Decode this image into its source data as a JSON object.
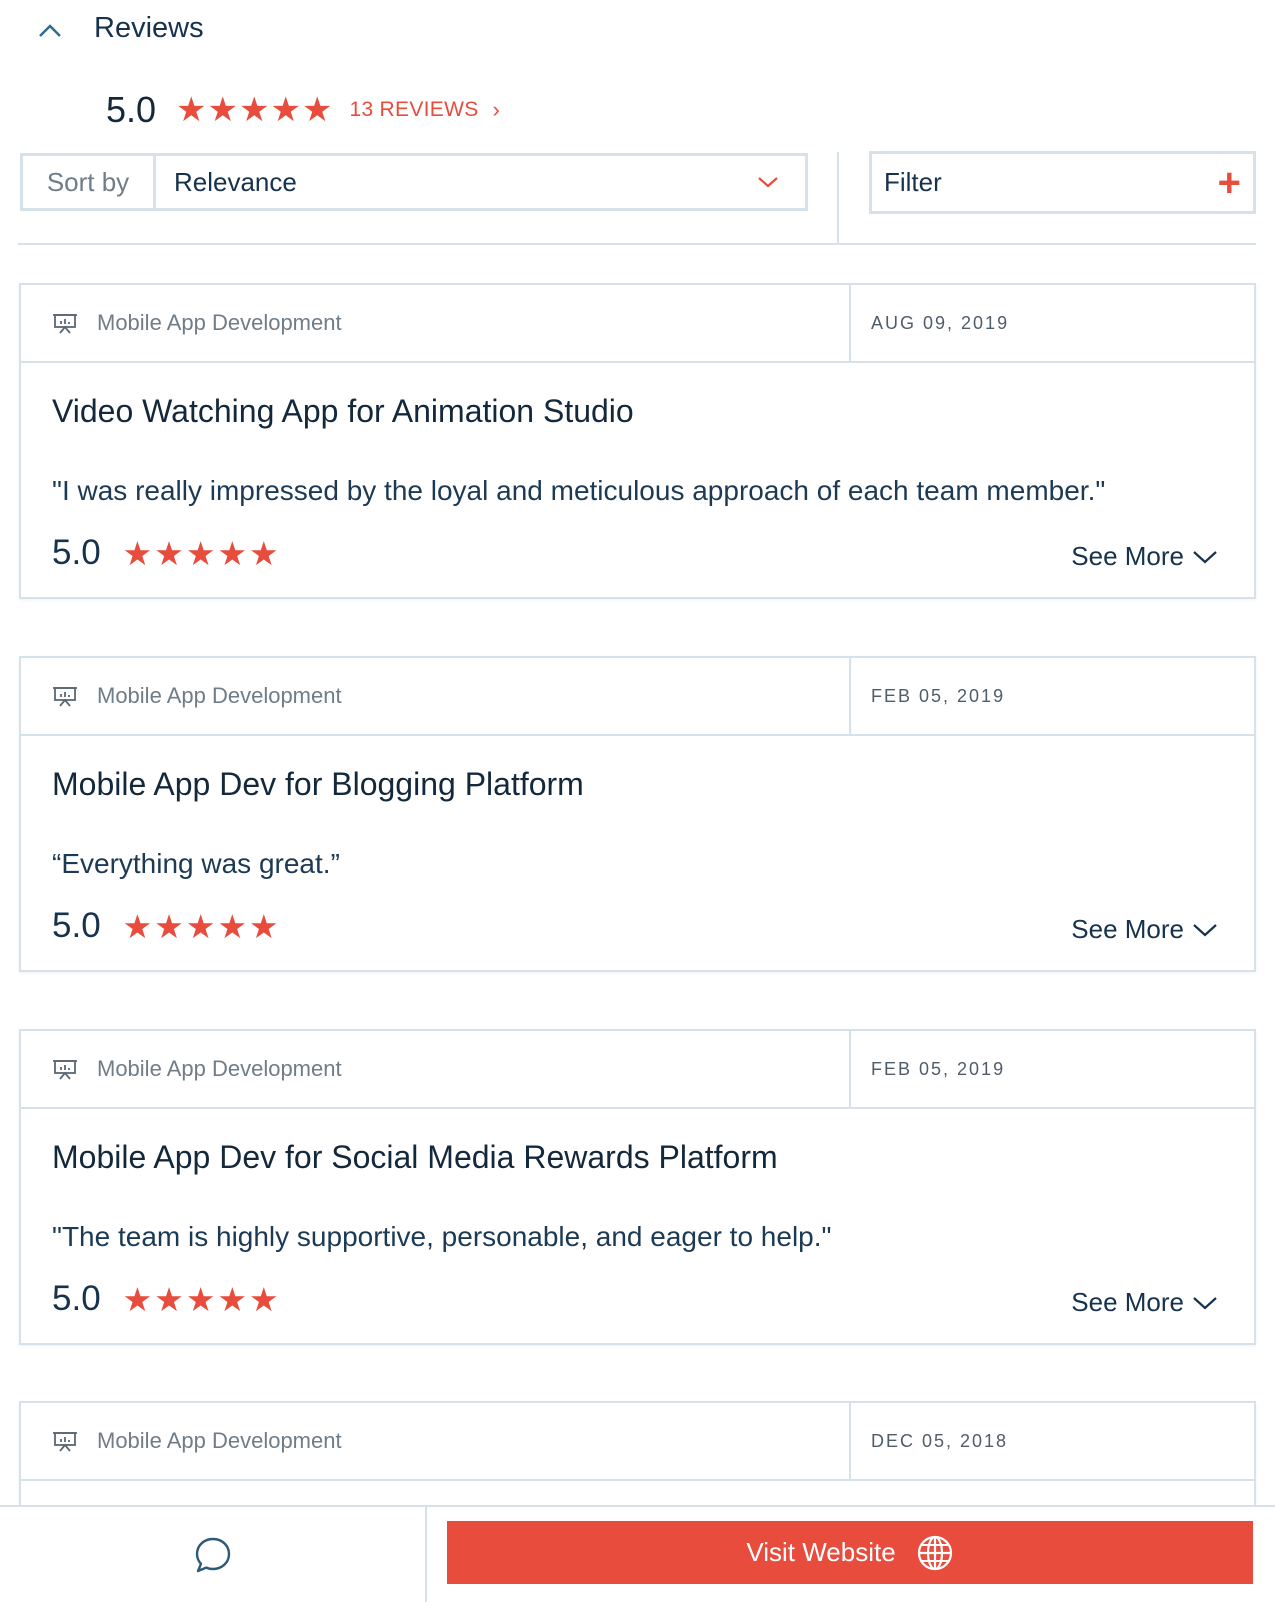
{
  "section": {
    "title": "Reviews"
  },
  "summary": {
    "score": "5.0",
    "stars": 5,
    "reviews_link": "13 REVIEWS"
  },
  "sort": {
    "label": "Sort by",
    "value": "Relevance"
  },
  "filter": {
    "label": "Filter"
  },
  "reviews": [
    {
      "category": "Mobile App Development",
      "date": "AUG 09, 2019",
      "title": "Video Watching App for Animation Studio",
      "quote": "\"I was really impressed by the loyal and meticulous approach of each team member.\"",
      "score": "5.0",
      "see_more": "See More"
    },
    {
      "category": "Mobile App Development",
      "date": "FEB 05, 2019",
      "title": "Mobile App Dev for Blogging Platform",
      "quote": "“Everything was great.”",
      "score": "5.0",
      "see_more": "See More"
    },
    {
      "category": "Mobile App Development",
      "date": "FEB 05, 2019",
      "title": "Mobile App Dev for Social Media Rewards Platform",
      "quote": "\"The team is highly supportive, personable, and eager to help.\"",
      "score": "5.0",
      "see_more": "See More"
    },
    {
      "category": "Mobile App Development",
      "date": "DEC 05, 2018",
      "title": "",
      "quote": "",
      "score": "",
      "see_more": ""
    }
  ],
  "bottom_bar": {
    "visit_label": "Visit Website"
  },
  "colors": {
    "accent": "#e84c3d",
    "text": "#17324d",
    "border": "#d5e2ea",
    "muted": "#6f7d88"
  },
  "icons": {
    "collapse": "chevron-up-icon",
    "reviews_link": "chevron-right-icon",
    "sort_dropdown": "chevron-down-icon",
    "filter": "plus-icon",
    "category": "presentation-icon",
    "see_more": "chevron-down-icon",
    "chat": "chat-bubble-icon",
    "website": "globe-icon"
  }
}
